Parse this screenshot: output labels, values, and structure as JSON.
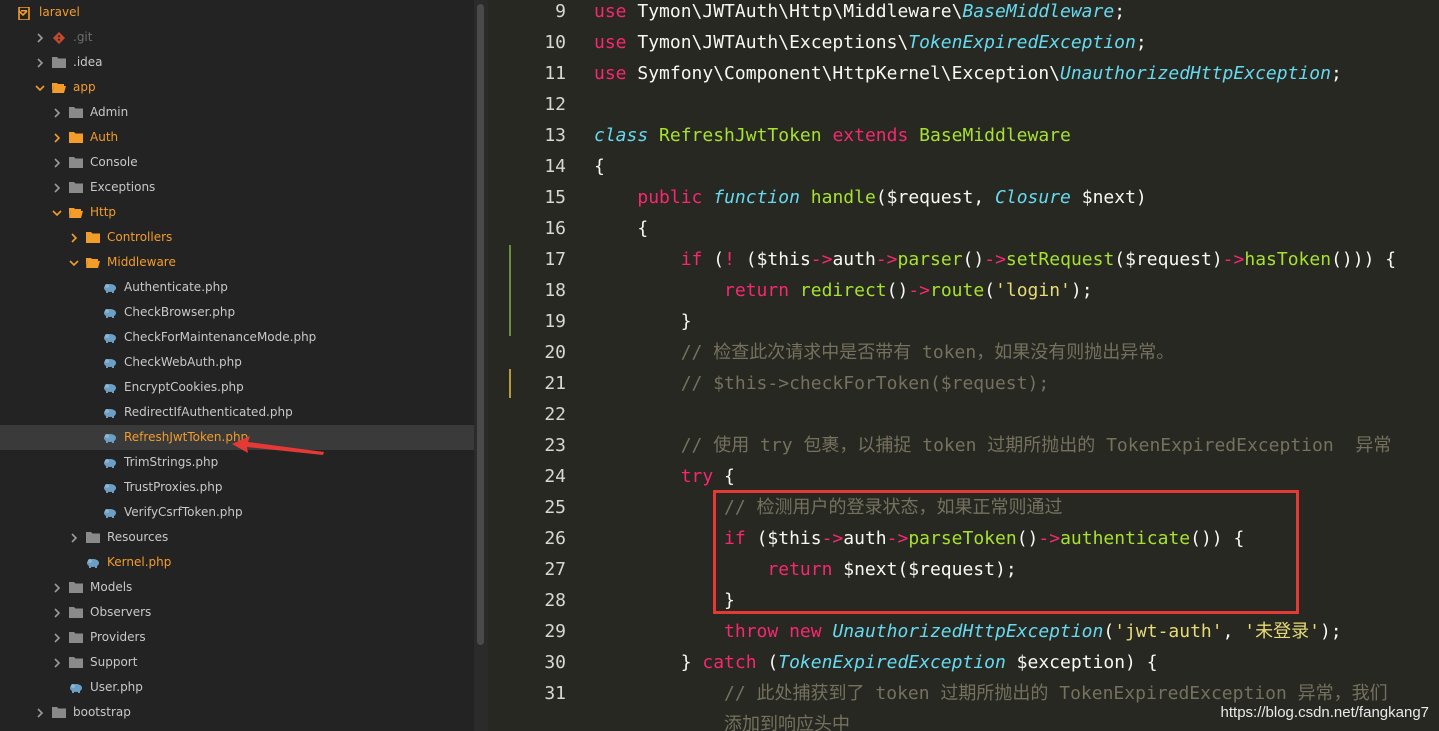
{
  "sidebar": {
    "items": [
      {
        "label": "laravel",
        "depth": 0,
        "arrow": "down",
        "icon": "folder-open",
        "style": "orange"
      },
      {
        "label": ".git",
        "depth": 1,
        "arrow": "right",
        "icon": "git",
        "style": "dim"
      },
      {
        "label": ".idea",
        "depth": 1,
        "arrow": "right",
        "icon": "folder",
        "style": ""
      },
      {
        "label": "app",
        "depth": 1,
        "arrow": "down",
        "icon": "folder-open",
        "style": "orange"
      },
      {
        "label": "Admin",
        "depth": 2,
        "arrow": "right",
        "icon": "folder",
        "style": ""
      },
      {
        "label": "Auth",
        "depth": 2,
        "arrow": "right",
        "icon": "folder-orange",
        "style": "orange"
      },
      {
        "label": "Console",
        "depth": 2,
        "arrow": "right",
        "icon": "folder",
        "style": ""
      },
      {
        "label": "Exceptions",
        "depth": 2,
        "arrow": "right",
        "icon": "folder",
        "style": ""
      },
      {
        "label": "Http",
        "depth": 2,
        "arrow": "down",
        "icon": "folder-open",
        "style": "orange"
      },
      {
        "label": "Controllers",
        "depth": 3,
        "arrow": "right",
        "icon": "folder-orange",
        "style": "orange"
      },
      {
        "label": "Middleware",
        "depth": 3,
        "arrow": "down",
        "icon": "folder-open",
        "style": "orange"
      },
      {
        "label": "Authenticate.php",
        "depth": 4,
        "arrow": "",
        "icon": "php",
        "style": ""
      },
      {
        "label": "CheckBrowser.php",
        "depth": 4,
        "arrow": "",
        "icon": "php",
        "style": ""
      },
      {
        "label": "CheckForMaintenanceMode.php",
        "depth": 4,
        "arrow": "",
        "icon": "php",
        "style": ""
      },
      {
        "label": "CheckWebAuth.php",
        "depth": 4,
        "arrow": "",
        "icon": "php",
        "style": ""
      },
      {
        "label": "EncryptCookies.php",
        "depth": 4,
        "arrow": "",
        "icon": "php",
        "style": ""
      },
      {
        "label": "RedirectIfAuthenticated.php",
        "depth": 4,
        "arrow": "",
        "icon": "php",
        "style": ""
      },
      {
        "label": "RefreshJwtToken.php",
        "depth": 4,
        "arrow": "",
        "icon": "php",
        "style": "orange",
        "selected": true
      },
      {
        "label": "TrimStrings.php",
        "depth": 4,
        "arrow": "",
        "icon": "php",
        "style": ""
      },
      {
        "label": "TrustProxies.php",
        "depth": 4,
        "arrow": "",
        "icon": "php",
        "style": ""
      },
      {
        "label": "VerifyCsrfToken.php",
        "depth": 4,
        "arrow": "",
        "icon": "php",
        "style": ""
      },
      {
        "label": "Resources",
        "depth": 3,
        "arrow": "right",
        "icon": "folder",
        "style": ""
      },
      {
        "label": "Kernel.php",
        "depth": 3,
        "arrow": "",
        "icon": "php",
        "style": "orange"
      },
      {
        "label": "Models",
        "depth": 2,
        "arrow": "right",
        "icon": "folder",
        "style": ""
      },
      {
        "label": "Observers",
        "depth": 2,
        "arrow": "right",
        "icon": "folder",
        "style": ""
      },
      {
        "label": "Providers",
        "depth": 2,
        "arrow": "right",
        "icon": "folder",
        "style": ""
      },
      {
        "label": "Support",
        "depth": 2,
        "arrow": "right",
        "icon": "folder",
        "style": ""
      },
      {
        "label": "User.php",
        "depth": 2,
        "arrow": "",
        "icon": "php",
        "style": ""
      },
      {
        "label": "bootstrap",
        "depth": 1,
        "arrow": "right",
        "icon": "folder",
        "style": ""
      }
    ]
  },
  "editor": {
    "lines": [
      {
        "n": "9",
        "t": [
          [
            "k",
            "use"
          ],
          [
            "p",
            " Tymon\\JWTAuth\\Http\\Middleware\\"
          ],
          [
            "s",
            "BaseMiddleware"
          ],
          [
            "p",
            ";"
          ]
        ]
      },
      {
        "n": "10",
        "t": [
          [
            "k",
            "use"
          ],
          [
            "p",
            " Tymon\\JWTAuth\\Exceptions\\"
          ],
          [
            "s",
            "TokenExpiredException"
          ],
          [
            "p",
            ";"
          ]
        ]
      },
      {
        "n": "11",
        "t": [
          [
            "k",
            "use"
          ],
          [
            "p",
            " Symfony\\Component\\HttpKernel\\Exception\\"
          ],
          [
            "s",
            "UnauthorizedHttpException"
          ],
          [
            "p",
            ";"
          ]
        ]
      },
      {
        "n": "12",
        "t": []
      },
      {
        "n": "13",
        "t": [
          [
            "s",
            "class"
          ],
          [
            "p",
            " "
          ],
          [
            "g",
            "RefreshJwtToken"
          ],
          [
            "p",
            " "
          ],
          [
            "k",
            "extends"
          ],
          [
            "p",
            " "
          ],
          [
            "g",
            "BaseMiddleware"
          ]
        ]
      },
      {
        "n": "14",
        "t": [
          [
            "p",
            "{"
          ]
        ]
      },
      {
        "n": "15",
        "t": [
          [
            "p",
            "    "
          ],
          [
            "k",
            "public"
          ],
          [
            "p",
            " "
          ],
          [
            "s",
            "function"
          ],
          [
            "p",
            " "
          ],
          [
            "g",
            "handle"
          ],
          [
            "p",
            "($request, "
          ],
          [
            "s",
            "Closure"
          ],
          [
            "p",
            " $next)"
          ]
        ]
      },
      {
        "n": "16",
        "t": [
          [
            "p",
            "    {"
          ]
        ]
      },
      {
        "n": "17",
        "t": [
          [
            "p",
            "        "
          ],
          [
            "k",
            "if"
          ],
          [
            "p",
            " ("
          ],
          [
            "k",
            "!"
          ],
          [
            "p",
            " ($this"
          ],
          [
            "k",
            "->"
          ],
          [
            "p",
            "auth"
          ],
          [
            "k",
            "->"
          ],
          [
            "g",
            "parser"
          ],
          [
            "p",
            "()"
          ],
          [
            "k",
            "->"
          ],
          [
            "g",
            "setRequest"
          ],
          [
            "p",
            "($request)"
          ],
          [
            "k",
            "->"
          ],
          [
            "g",
            "hasToken"
          ],
          [
            "p",
            "())) {"
          ]
        ]
      },
      {
        "n": "18",
        "t": [
          [
            "p",
            "            "
          ],
          [
            "k",
            "return"
          ],
          [
            "p",
            " "
          ],
          [
            "g",
            "redirect"
          ],
          [
            "p",
            "()"
          ],
          [
            "k",
            "->"
          ],
          [
            "g",
            "route"
          ],
          [
            "p",
            "("
          ],
          [
            "y",
            "'login'"
          ],
          [
            "p",
            ");"
          ]
        ]
      },
      {
        "n": "19",
        "t": [
          [
            "p",
            "        }"
          ]
        ]
      },
      {
        "n": "20",
        "t": [
          [
            "p",
            "        "
          ],
          [
            "c",
            "// 检查此次请求中是否带有 token，如果没有则抛出异常。"
          ]
        ]
      },
      {
        "n": "21",
        "t": [
          [
            "p",
            "        "
          ],
          [
            "c",
            "// $this->checkForToken($request);"
          ]
        ]
      },
      {
        "n": "22",
        "t": []
      },
      {
        "n": "23",
        "t": [
          [
            "p",
            "        "
          ],
          [
            "c",
            "// 使用 try 包裹，以捕捉 token 过期所抛出的 TokenExpiredException  异常"
          ]
        ]
      },
      {
        "n": "24",
        "t": [
          [
            "p",
            "        "
          ],
          [
            "k",
            "try"
          ],
          [
            "p",
            " {"
          ]
        ]
      },
      {
        "n": "25",
        "t": [
          [
            "p",
            "            "
          ],
          [
            "c",
            "// 检测用户的登录状态，如果正常则通过"
          ]
        ]
      },
      {
        "n": "26",
        "t": [
          [
            "p",
            "            "
          ],
          [
            "k",
            "if"
          ],
          [
            "p",
            " ($this"
          ],
          [
            "k",
            "->"
          ],
          [
            "p",
            "auth"
          ],
          [
            "k",
            "->"
          ],
          [
            "g",
            "parseToken"
          ],
          [
            "p",
            "()"
          ],
          [
            "k",
            "->"
          ],
          [
            "g",
            "authenticate"
          ],
          [
            "p",
            "()) {"
          ]
        ]
      },
      {
        "n": "27",
        "t": [
          [
            "p",
            "                "
          ],
          [
            "k",
            "return"
          ],
          [
            "p",
            " $next($request);"
          ]
        ]
      },
      {
        "n": "28",
        "t": [
          [
            "p",
            "            }"
          ]
        ]
      },
      {
        "n": "29",
        "t": [
          [
            "p",
            "            "
          ],
          [
            "k",
            "throw"
          ],
          [
            "p",
            " "
          ],
          [
            "k",
            "new"
          ],
          [
            "p",
            " "
          ],
          [
            "s",
            "UnauthorizedHttpException"
          ],
          [
            "p",
            "("
          ],
          [
            "y",
            "'jwt-auth'"
          ],
          [
            "p",
            ", "
          ],
          [
            "y",
            "'未登录'"
          ],
          [
            "p",
            ");"
          ]
        ]
      },
      {
        "n": "30",
        "t": [
          [
            "p",
            "        } "
          ],
          [
            "k",
            "catch"
          ],
          [
            "p",
            " ("
          ],
          [
            "s",
            "TokenExpiredException"
          ],
          [
            "p",
            " $exception) {"
          ]
        ]
      },
      {
        "n": "31",
        "t": [
          [
            "p",
            "            "
          ],
          [
            "c",
            "// 此处捕获到了 token 过期所抛出的 TokenExpiredException 异常，我们"
          ]
        ]
      },
      {
        "n": "",
        "t": [
          [
            "p",
            "            "
          ],
          [
            "c",
            "添加到响应头中"
          ]
        ]
      }
    ]
  },
  "watermark": "https://blog.csdn.net/fangkang7"
}
